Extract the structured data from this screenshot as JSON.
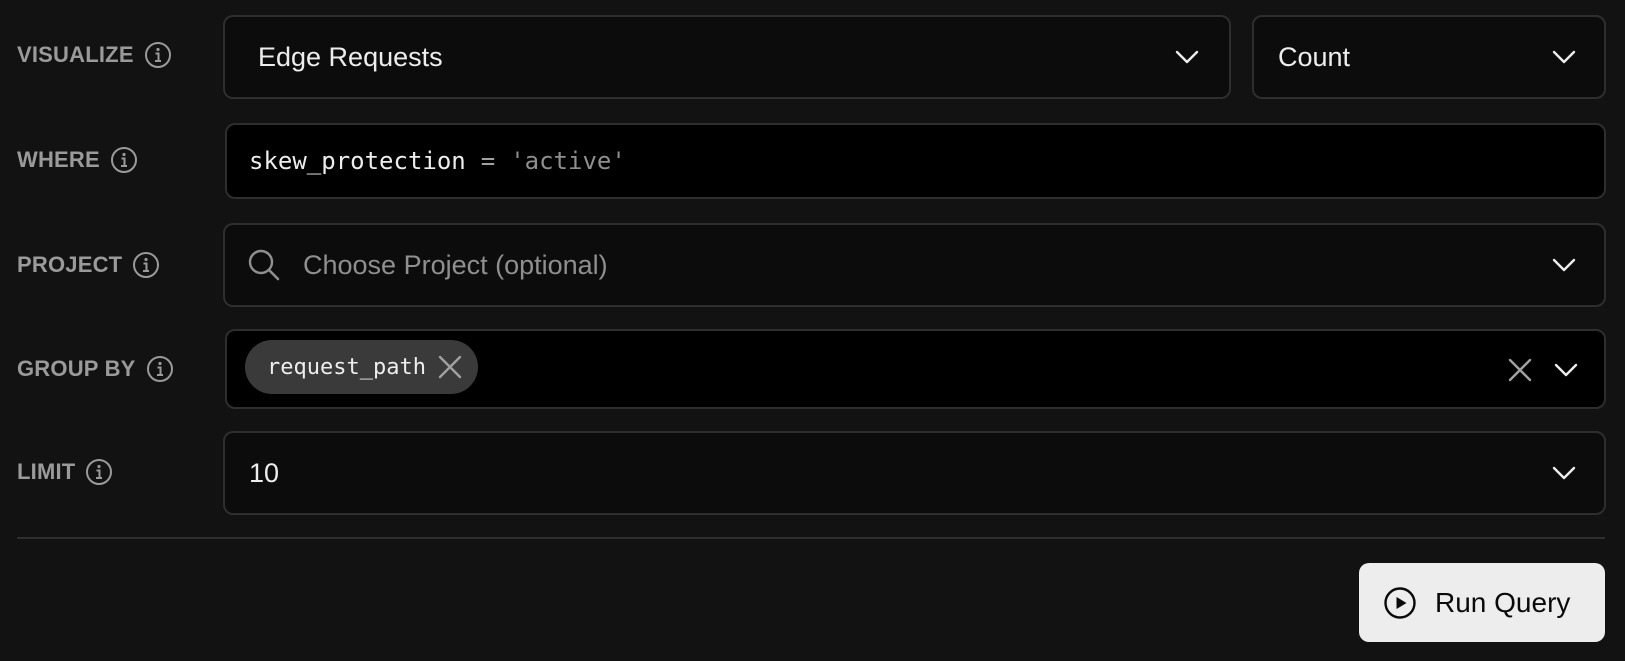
{
  "rows": {
    "visualize": {
      "label": "VISUALIZE",
      "metric": "Edge Requests",
      "aggregation": "Count"
    },
    "where": {
      "label": "WHERE",
      "field": "skew_protection",
      "operator": "=",
      "value": "'active'"
    },
    "project": {
      "label": "PROJECT",
      "placeholder": "Choose Project (optional)"
    },
    "group_by": {
      "label": "GROUP BY",
      "chips": [
        "request_path"
      ]
    },
    "limit": {
      "label": "LIMIT",
      "value": "10"
    }
  },
  "actions": {
    "run_label": "Run Query"
  },
  "icons": {
    "info": "info-circle-icon",
    "chevron": "chevron-down-icon",
    "search": "search-icon",
    "clear": "close-icon",
    "play": "play-circle-icon"
  },
  "colors": {
    "background": "#121212",
    "field_border": "#2e2e2e",
    "label": "#9a9a9a",
    "button_bg": "#ededed"
  }
}
